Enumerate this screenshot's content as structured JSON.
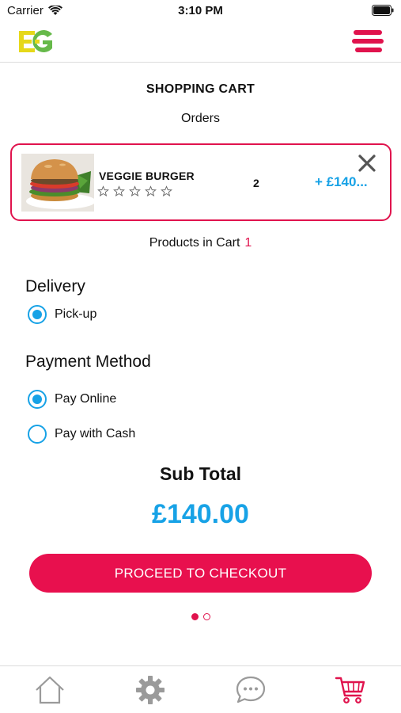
{
  "status_bar": {
    "carrier": "Carrier",
    "time": "3:10 PM"
  },
  "header": {
    "logo_icon": "app-logo-icon",
    "menu_icon": "hamburger-menu-icon"
  },
  "page": {
    "title": "SHOPPING CART",
    "subtitle": "Orders"
  },
  "cart": {
    "items": [
      {
        "name": "VEGGIE BURGER",
        "rating_stars": 0,
        "rating_max": 5,
        "quantity": "2",
        "price": "+ £140..."
      }
    ],
    "products_label": "Products in Cart",
    "products_count": "1"
  },
  "delivery": {
    "heading": "Delivery",
    "options": [
      {
        "label": "Pick-up",
        "selected": true
      }
    ]
  },
  "payment": {
    "heading": "Payment Method",
    "options": [
      {
        "label": "Pay Online",
        "selected": true
      },
      {
        "label": "Pay with Cash",
        "selected": false
      }
    ]
  },
  "summary": {
    "subtotal_label": "Sub Total",
    "subtotal_value": "£140.00",
    "checkout_label": "PROCEED TO CHECKOUT"
  },
  "pager": {
    "pages": 2,
    "current": 1
  },
  "tab_bar": {
    "tabs": [
      {
        "icon": "home-icon",
        "active": false
      },
      {
        "icon": "gear-icon",
        "active": false
      },
      {
        "icon": "chat-bubble-icon",
        "active": false
      },
      {
        "icon": "shopping-cart-icon",
        "active": true
      }
    ]
  },
  "colors": {
    "accent": "#e0134d",
    "price_blue": "#17a2e6",
    "inactive_icon": "#9a9a9a"
  }
}
